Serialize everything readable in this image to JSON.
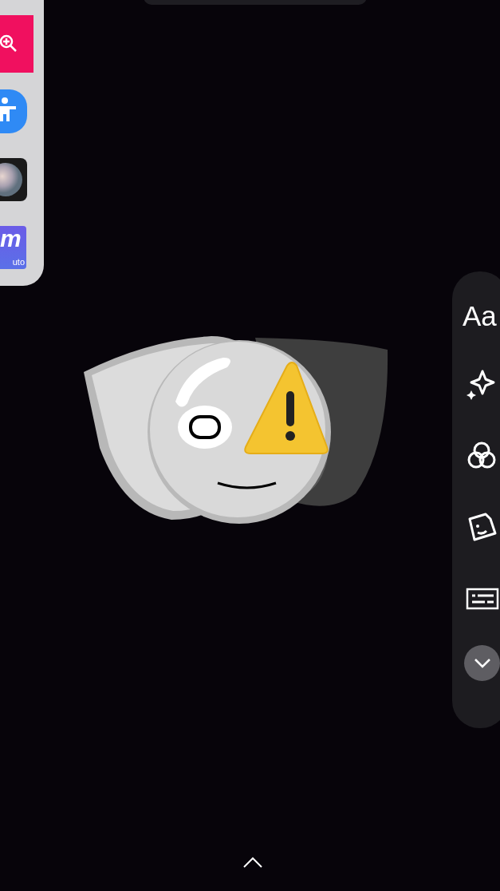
{
  "app_dock": {
    "apps": [
      {
        "kind": "magnifier"
      },
      {
        "kind": "accessibility"
      },
      {
        "kind": "lens"
      },
      {
        "kind": "logo",
        "logo": "m",
        "caption": "uto"
      }
    ]
  },
  "tool_bar": {
    "items": [
      {
        "kind": "text",
        "label": "Aa"
      },
      {
        "kind": "sparkle"
      },
      {
        "kind": "filters"
      },
      {
        "kind": "sticker"
      },
      {
        "kind": "captions"
      },
      {
        "kind": "expand"
      }
    ]
  }
}
